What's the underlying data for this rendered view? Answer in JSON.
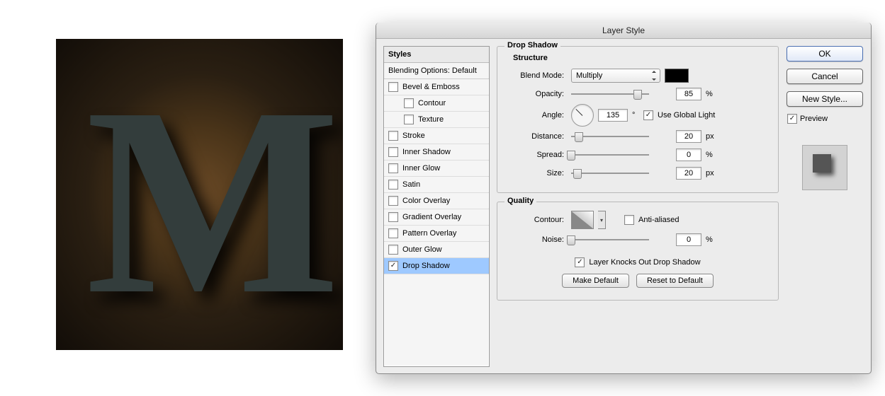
{
  "dialog_title": "Layer Style",
  "styles_header": "Styles",
  "blending_label": "Blending Options: Default",
  "styles": [
    {
      "label": "Bevel & Emboss",
      "checked": false,
      "indent": false,
      "selected": false
    },
    {
      "label": "Contour",
      "checked": false,
      "indent": true,
      "selected": false
    },
    {
      "label": "Texture",
      "checked": false,
      "indent": true,
      "selected": false
    },
    {
      "label": "Stroke",
      "checked": false,
      "indent": false,
      "selected": false
    },
    {
      "label": "Inner Shadow",
      "checked": false,
      "indent": false,
      "selected": false
    },
    {
      "label": "Inner Glow",
      "checked": false,
      "indent": false,
      "selected": false
    },
    {
      "label": "Satin",
      "checked": false,
      "indent": false,
      "selected": false
    },
    {
      "label": "Color Overlay",
      "checked": false,
      "indent": false,
      "selected": false
    },
    {
      "label": "Gradient Overlay",
      "checked": false,
      "indent": false,
      "selected": false
    },
    {
      "label": "Pattern Overlay",
      "checked": false,
      "indent": false,
      "selected": false
    },
    {
      "label": "Outer Glow",
      "checked": false,
      "indent": false,
      "selected": false
    },
    {
      "label": "Drop Shadow",
      "checked": true,
      "indent": false,
      "selected": true
    }
  ],
  "structure_group": "Drop Shadow",
  "structure_subtitle": "Structure",
  "labels": {
    "blend_mode": "Blend Mode:",
    "opacity": "Opacity:",
    "angle": "Angle:",
    "distance": "Distance:",
    "spread": "Spread:",
    "size": "Size:",
    "contour": "Contour:",
    "noise": "Noise:",
    "quality": "Quality",
    "anti_aliased": "Anti-aliased",
    "layer_knocks": "Layer Knocks Out Drop Shadow",
    "use_global": "Use Global Light",
    "make_default": "Make Default",
    "reset_default": "Reset to Default",
    "ok": "OK",
    "cancel": "Cancel",
    "new_style": "New Style...",
    "preview": "Preview",
    "degree": "°",
    "percent": "%",
    "px": "px"
  },
  "values": {
    "blend_mode": "Multiply",
    "color": "#000000",
    "opacity": "85",
    "angle": "135",
    "use_global": true,
    "distance": "20",
    "spread": "0",
    "size": "20",
    "anti_aliased": false,
    "noise": "0",
    "layer_knocks": true,
    "preview": true
  },
  "slider_positions": {
    "opacity": 85,
    "distance": 10,
    "spread": 0,
    "size": 8,
    "noise": 0
  }
}
